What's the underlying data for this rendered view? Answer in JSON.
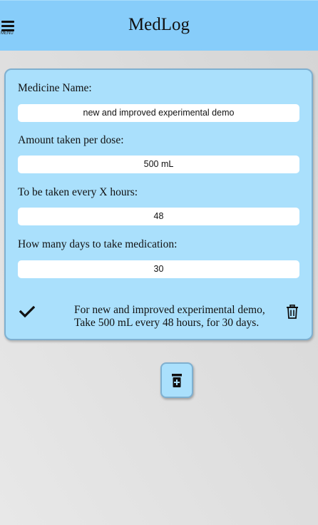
{
  "header": {
    "title": "MedLog",
    "menu_label": "MENU",
    "menu_icon": "hamburger-icon"
  },
  "form": {
    "medicine_name": {
      "label": "Medicine Name:",
      "value": "new and improved experimental demo"
    },
    "amount": {
      "label": "Amount taken per dose:",
      "value": "500 mL"
    },
    "interval": {
      "label": "To be taken every X hours:",
      "value": "48"
    },
    "days": {
      "label": "How many days to take medication:",
      "value": "30"
    }
  },
  "summary": {
    "line1": "For new and improved experimental demo,",
    "line2": "Take 500 mL every 48 hours, for 30 days.",
    "confirm_icon": "checkmark-icon",
    "delete_icon": "trash-icon"
  },
  "add_button": {
    "icon": "pill-bottle-plus-icon"
  },
  "colors": {
    "header": "#87cdfa",
    "card": "#aae0fc",
    "card_border": "#7fb0d0"
  }
}
